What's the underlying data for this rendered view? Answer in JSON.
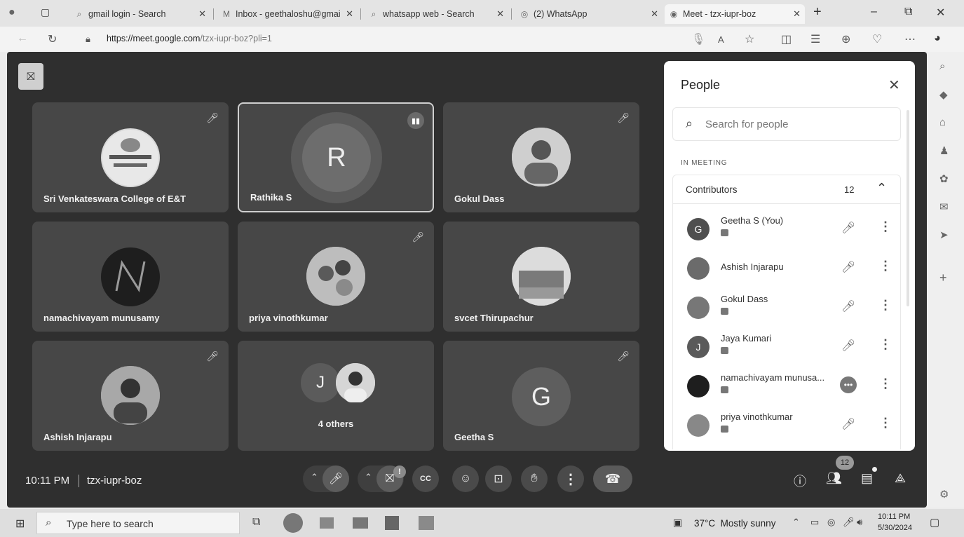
{
  "tabs": [
    {
      "icon": "search-icon",
      "label": "gmail login - Search"
    },
    {
      "icon": "gmail-icon",
      "label": "Inbox - geethaloshu@gmai"
    },
    {
      "icon": "search-icon",
      "label": "whatsapp web - Search"
    },
    {
      "icon": "whatsapp-icon",
      "label": "(2) WhatsApp"
    },
    {
      "icon": "meet-icon",
      "label": "Meet - tzx-iupr-boz"
    }
  ],
  "address": {
    "domain": "https://meet.google.com",
    "path": "/tzx-iupr-boz?pli=1"
  },
  "tiles": [
    {
      "name": "Sri Venkateswara College of E&T",
      "avatar": "",
      "muted": true
    },
    {
      "name": "Rathika S",
      "avatar": "R",
      "muted": false
    },
    {
      "name": "Gokul Dass",
      "avatar": "",
      "muted": true
    },
    {
      "name": "namachivayam munusamy",
      "avatar": "",
      "muted": false
    },
    {
      "name": "priya vinothkumar",
      "avatar": "",
      "muted": true
    },
    {
      "name": "svcet Thirupachur",
      "avatar": "",
      "muted": false
    },
    {
      "name": "Ashish Injarapu",
      "avatar": "",
      "muted": true
    },
    {
      "name": "4 others",
      "avatar": "J",
      "muted": false
    },
    {
      "name": "Geetha S",
      "avatar": "G",
      "muted": true
    }
  ],
  "people_panel": {
    "title": "People",
    "search_placeholder": "Search for people",
    "section_label": "IN MEETING",
    "group_label": "Contributors",
    "group_count": "12",
    "participants": [
      {
        "name": "Geetha S (You)",
        "avatar": "G"
      },
      {
        "name": "Ashish Injarapu",
        "avatar": ""
      },
      {
        "name": "Gokul Dass",
        "avatar": ""
      },
      {
        "name": "Jaya Kumari",
        "avatar": "J"
      },
      {
        "name": "namachivayam munusa...",
        "avatar": ""
      },
      {
        "name": "priya vinothkumar",
        "avatar": ""
      }
    ]
  },
  "meeting_info": {
    "time": "10:11 PM",
    "code": "tzx-iupr-boz"
  },
  "people_badge": "12",
  "cam_badge": "!",
  "taskbar": {
    "search_placeholder": "Type here to search",
    "weather": "37°C  Mostly sunny",
    "clock_time": "10:11 PM",
    "clock_date": "5/30/2024"
  },
  "colors": {
    "meet_bg": "#2f2f2f",
    "tile_bg": "#474747",
    "end_call": "#555555",
    "accent_border": "#cfcfcf"
  }
}
